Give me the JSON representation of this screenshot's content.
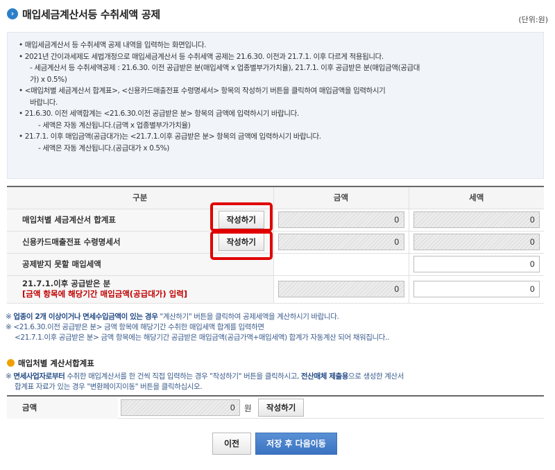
{
  "header": {
    "title": "매입세금계산서등 수취세액 공제",
    "unit": "(단위:원)",
    "icon": "chevron-right-icon"
  },
  "info": {
    "l1": "• 매입세금계산서 등 수취세액 공제 내역을 입력하는 화면입니다.",
    "l2": "• 2021년 간이과세제도 세법개정으로 매입세금계산서 등 수취세액 공제는 21.6.30. 이전과 21.7.1. 이후 다르게 적용됩니다.",
    "l3": "- 세금계산서 등 수취세액공제 : 21.6.30. 이전 공급받은 분(매입세액 x 업종별부가가치율), 21.7.1. 이후 공급받은 분(매입금액(공급대",
    "l4": "가) x 0.5%)",
    "l5": "• <매입처별 세금계산서 합계표>, <신용카드매출전표 수령명세서> 항목의 작성하기 버튼을 클릭하여 매입금액을 입력하시기",
    "l6": "바랍니다.",
    "l7": "• 21.6.30. 이전 세액합계는 <21.6.30.이전 공급받은 분> 항목의 금액에 입력하시기 바랍니다.",
    "l8": "- 세액은 자동 계산됩니다.(금액 x 업종별부가가치율)",
    "l9": "• 21.7.1. 이후 매입금액(공급대가)는 <21.7.1.이후 공급받은 분> 항목의 금액에 입력하시기 바랍니다.",
    "l10": "- 세액은 자동 계산됩니다.(공급대가 x 0.5%)"
  },
  "table": {
    "col_category": "구분",
    "col_amount": "금액",
    "col_tax": "세액",
    "row1": {
      "label": "매입처별 세금계산서 합계표",
      "button": "작성하기",
      "amount": "0",
      "tax": "0"
    },
    "row2": {
      "label": "신용카드매출전표 수령명세서",
      "button": "작성하기",
      "amount": "0",
      "tax": "0"
    },
    "row3": {
      "label": "공제받지 못할 매입세액",
      "tax": "0"
    },
    "row4": {
      "label": "21.7.1.이후 공급받은 분",
      "note": "[금액 항목에 해당기간 매입금액(공급대가) 입력]",
      "amount": "0",
      "tax": "0"
    }
  },
  "notes": {
    "n1_mark": "※",
    "n1_em1": "업종이 2개 이상이거나",
    "n1_em2": "면세수입금액이 있는 경우",
    "n1_rest": "\"계산하기\" 버튼을 클릭하여 공제세액을 계산하시기 바랍니다.",
    "n2": "※ <21.6.30.이전 공급받은 분> 금액 항목에 해당기간 수취한 매입세액 합계를 입력하면",
    "n3": "<21.7.1.이후 공급받은 분> 금액 항목에는 해당기간 공급받은 매입금액(공급가액+매입세액) 합계가 자동계산 되어 채워집니다.."
  },
  "sub": {
    "title": "매입처별 계산서합계표",
    "note_mark": "※",
    "note_em1": "면세사업자로부터",
    "note_mid": "수취한 매입계산서를 한 건씩 직접 입력하는 경우 \"작성하기\" 버튼을 클릭하시고,",
    "note_em2": "전산매체 제출용",
    "note_end": "으로 생성한 계산서",
    "note2": "합계표 자료가 있는 경우 \"변환페이지이동\" 버튼을 클릭하십시오.",
    "amount_label": "금액",
    "amount_value": "0",
    "won": "원",
    "button": "작성하기"
  },
  "footer": {
    "prev": "이전",
    "next": "저장 후 다음이동"
  },
  "colors": {
    "accent": "#3a73c2",
    "highlight": "#e00000",
    "warning": "#c00000"
  }
}
